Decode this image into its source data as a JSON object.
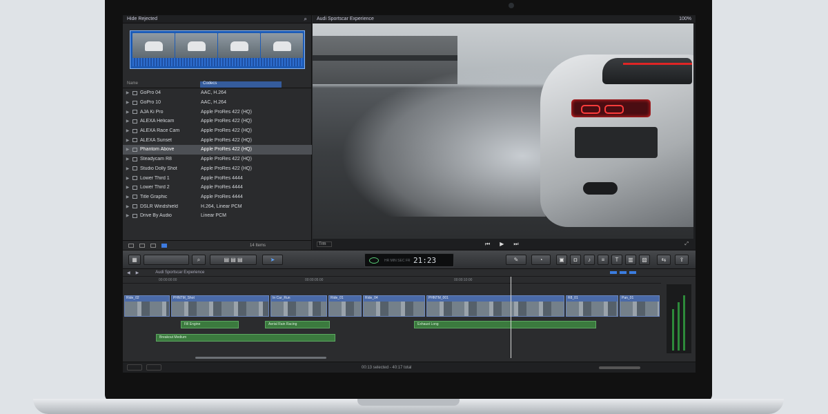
{
  "browser": {
    "header": "Hide Rejected",
    "columns": [
      "Name",
      "Codecs"
    ],
    "items": [
      {
        "name": "GoPro 04",
        "codec": "AAC, H.264"
      },
      {
        "name": "GoPro 10",
        "codec": "AAC, H.264"
      },
      {
        "name": "AJA Ki Pro",
        "codec": "Apple ProRes 422 (HQ)"
      },
      {
        "name": "ALEXA Helicam",
        "codec": "Apple ProRes 422 (HQ)"
      },
      {
        "name": "ALEXA Race Cam",
        "codec": "Apple ProRes 422 (HQ)"
      },
      {
        "name": "ALEXA Sunset",
        "codec": "Apple ProRes 422 (HQ)"
      },
      {
        "name": "Phantom Above",
        "codec": "Apple ProRes 422 (HQ)"
      },
      {
        "name": "Steadycam R8",
        "codec": "Apple ProRes 422 (HQ)"
      },
      {
        "name": "Studio Dolly Shot",
        "codec": "Apple ProRes 422 (HQ)"
      },
      {
        "name": "Lower Third 1",
        "codec": "Apple ProRes 4444"
      },
      {
        "name": "Lower Third 2",
        "codec": "Apple ProRes 4444"
      },
      {
        "name": "Title Graphic",
        "codec": "Apple ProRes 4444"
      },
      {
        "name": "DSLR Windshield",
        "codec": "H.264, Linear PCM"
      },
      {
        "name": "Drive By Audio",
        "codec": "Linear PCM"
      }
    ],
    "selected_index": 6,
    "footer_count": "14 Items"
  },
  "viewer": {
    "title": "Audi Sportscar Experience",
    "zoom": "100%",
    "transform": "Trm"
  },
  "toolbar": {
    "timecode": "21:23"
  },
  "timeline": {
    "project": "Audi Sportscar Experience",
    "ruler": [
      "00:00:00:00",
      "00:00:05:00",
      "00:00:10:00"
    ],
    "clips": [
      {
        "name": "Ride_02"
      },
      {
        "name": "PHNTM_Shot"
      },
      {
        "name": "In Car_Run"
      },
      {
        "name": "Ride_01"
      },
      {
        "name": "Ride_04"
      },
      {
        "name": "PHNTM_001"
      },
      {
        "name": "R8_01"
      },
      {
        "name": "Pan_01"
      }
    ],
    "audio": [
      {
        "name": "Fill Engine"
      },
      {
        "name": "Aerial Rain Racing"
      },
      {
        "name": "Exhaust Long"
      },
      {
        "name": "Breakout Medium"
      }
    ],
    "status": "00:13 selected - 40:17 total"
  },
  "colors": {
    "accent": "#3d7be0",
    "clip": "#4a6aa8",
    "audio": "#3b7a3e"
  }
}
